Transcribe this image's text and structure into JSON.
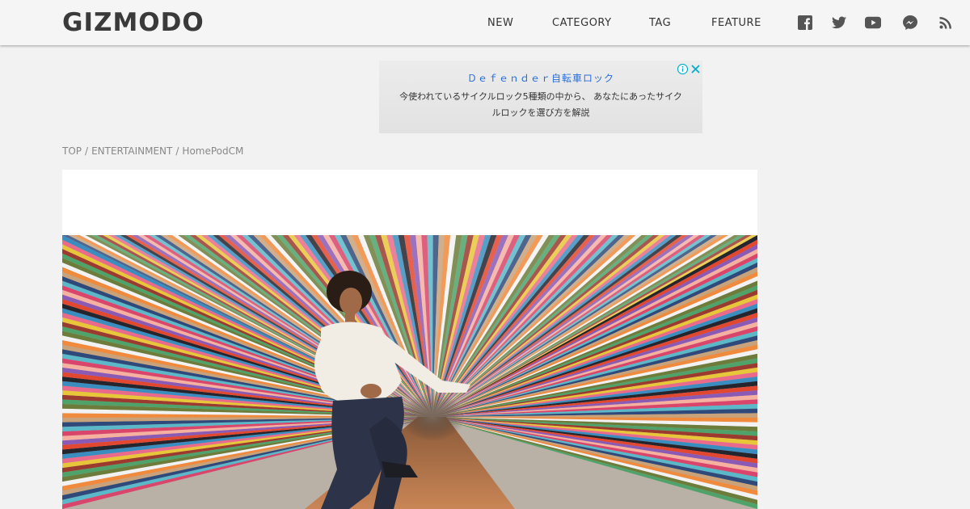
{
  "header": {
    "logo": "GIZMODO",
    "nav": [
      {
        "label": "NEW"
      },
      {
        "label": "CATEGORY"
      },
      {
        "label": "TAG"
      },
      {
        "label": "FEATURE"
      }
    ],
    "social_icons": [
      "facebook-icon",
      "twitter-icon",
      "youtube-icon",
      "messenger-icon",
      "rss-icon"
    ]
  },
  "ad": {
    "title": "Ｄｅｆｅｎｄｅｒ自転車ロック",
    "body": "今使われているサイクルロック5種類の中から、 あなたにあったサイクルロックを選び方を解説",
    "icons": [
      "adchoices-icon",
      "close-icon"
    ]
  },
  "breadcrumb": [
    {
      "label": "TOP"
    },
    {
      "label": "ENTERTAINMENT"
    },
    {
      "label": "HomePodCM"
    }
  ],
  "breadcrumb_separator": "/",
  "colors": {
    "header_bg": "#f5f5f5",
    "page_bg": "#f2f2f2",
    "ad_link": "#2a6ed8",
    "logo": "#3a3a3a"
  }
}
